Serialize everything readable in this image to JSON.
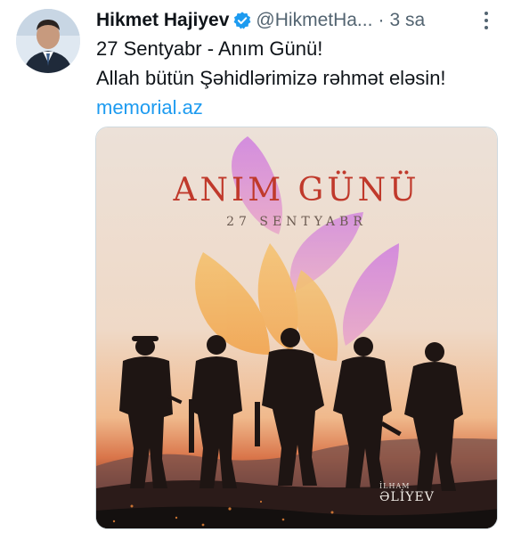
{
  "tweet": {
    "author": {
      "display_name": "Hikmet Hajiyev",
      "handle": "@HikmetHa...",
      "time": "3 sa",
      "separator": "·",
      "verified_icon": "verified-badge-icon"
    },
    "text_lines": [
      "27 Sentyabr - Anım Günü!",
      "Allah bütün Şəhidlərimizə rəhmət eləsin!"
    ],
    "link": "memorial.az",
    "media": {
      "title": "ANIM GÜNÜ",
      "subtitle": "27 SENTYABR",
      "signature_name": "İLHAM",
      "signature_surname": "ƏLİYEV"
    }
  },
  "colors": {
    "link": "#1d9bf0",
    "secondary_text": "#536471",
    "title_red": "#c0392b",
    "flower_purple": "#c77dd6",
    "flower_orange": "#f2a34a",
    "verified_blue": "#1d9bf0"
  }
}
